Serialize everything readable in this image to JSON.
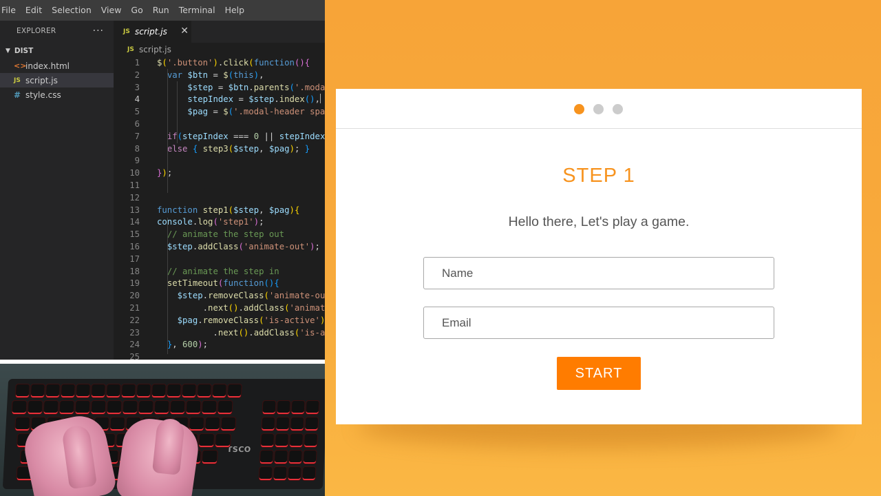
{
  "menubar": {
    "items": [
      "File",
      "Edit",
      "Selection",
      "View",
      "Go",
      "Run",
      "Terminal",
      "Help"
    ]
  },
  "explorer": {
    "title": "EXPLORER",
    "more": "···",
    "folder": "DIST",
    "files": [
      {
        "name": "index.html",
        "icon": "html-file-icon",
        "glyph": "<>"
      },
      {
        "name": "script.js",
        "icon": "js-file-icon",
        "glyph": "JS"
      },
      {
        "name": "style.css",
        "icon": "css-file-icon",
        "glyph": "#"
      }
    ],
    "active_file": "script.js"
  },
  "tab": {
    "label": "script.js",
    "icon_glyph": "JS",
    "close": "✕"
  },
  "breadcrumb": {
    "icon_glyph": "JS",
    "label": "script.js"
  },
  "editor": {
    "current_line": 4,
    "lines": [
      {
        "n": "1",
        "tokens": [
          [
            "fn",
            "$"
          ],
          [
            "t-brk1",
            "("
          ],
          [
            "str",
            "'.button'"
          ],
          [
            "t-brk1",
            ")"
          ],
          [
            "pun",
            "."
          ],
          [
            "fn",
            "click"
          ],
          [
            "t-brk1",
            "("
          ],
          [
            "kw",
            "function"
          ],
          [
            "t-brk2",
            "()"
          ],
          [
            "t-brk2",
            "{"
          ]
        ]
      },
      {
        "n": "2",
        "tokens": [
          [
            "pun",
            "  "
          ],
          [
            "kw",
            "var"
          ],
          [
            "pun",
            " "
          ],
          [
            "var",
            "$btn"
          ],
          [
            "pun",
            " = "
          ],
          [
            "fn",
            "$"
          ],
          [
            "t-brk3",
            "("
          ],
          [
            "kw",
            "this"
          ],
          [
            "t-brk3",
            ")"
          ],
          [
            "pun",
            ","
          ]
        ]
      },
      {
        "n": "3",
        "tokens": [
          [
            "pun",
            "      "
          ],
          [
            "var",
            "$step"
          ],
          [
            "pun",
            " = "
          ],
          [
            "var",
            "$btn"
          ],
          [
            "pun",
            "."
          ],
          [
            "fn",
            "parents"
          ],
          [
            "t-brk3",
            "("
          ],
          [
            "str",
            "'.modal"
          ]
        ]
      },
      {
        "n": "4",
        "tokens": [
          [
            "pun",
            "      "
          ],
          [
            "var",
            "stepIndex"
          ],
          [
            "pun",
            " = "
          ],
          [
            "var",
            "$step"
          ],
          [
            "pun",
            "."
          ],
          [
            "fn",
            "index"
          ],
          [
            "t-brk3",
            "()"
          ],
          [
            "pun",
            ","
          ],
          [
            "caret",
            ""
          ]
        ]
      },
      {
        "n": "5",
        "tokens": [
          [
            "pun",
            "      "
          ],
          [
            "var",
            "$pag"
          ],
          [
            "pun",
            " = "
          ],
          [
            "fn",
            "$"
          ],
          [
            "t-brk3",
            "("
          ],
          [
            "str",
            "'.modal-header span"
          ]
        ]
      },
      {
        "n": "6",
        "tokens": []
      },
      {
        "n": "7",
        "tokens": [
          [
            "pun",
            "  "
          ],
          [
            "ctl",
            "if"
          ],
          [
            "t-brk3",
            "("
          ],
          [
            "var",
            "stepIndex"
          ],
          [
            "pun",
            " === "
          ],
          [
            "num",
            "0"
          ],
          [
            "pun",
            " || "
          ],
          [
            "var",
            "stepIndex"
          ]
        ]
      },
      {
        "n": "8",
        "tokens": [
          [
            "pun",
            "  "
          ],
          [
            "ctl",
            "else"
          ],
          [
            "pun",
            " "
          ],
          [
            "t-brk3",
            "{"
          ],
          [
            "pun",
            " "
          ],
          [
            "fn",
            "step3"
          ],
          [
            "t-brk1",
            "("
          ],
          [
            "var",
            "$step"
          ],
          [
            "pun",
            ", "
          ],
          [
            "var",
            "$pag"
          ],
          [
            "t-brk1",
            ")"
          ],
          [
            "pun",
            "; "
          ],
          [
            "t-brk3",
            "}"
          ]
        ]
      },
      {
        "n": "9",
        "tokens": []
      },
      {
        "n": "10",
        "tokens": [
          [
            "t-brk2",
            "}"
          ],
          [
            "t-brk1",
            ")"
          ],
          [
            "pun",
            ";"
          ]
        ]
      },
      {
        "n": "11",
        "tokens": []
      },
      {
        "n": "12",
        "tokens": []
      },
      {
        "n": "13",
        "tokens": [
          [
            "kw",
            "function"
          ],
          [
            "pun",
            " "
          ],
          [
            "fn",
            "step1"
          ],
          [
            "t-brk1",
            "("
          ],
          [
            "var",
            "$step"
          ],
          [
            "pun",
            ", "
          ],
          [
            "var",
            "$pag"
          ],
          [
            "t-brk1",
            ")"
          ],
          [
            "t-brk1",
            "{"
          ]
        ]
      },
      {
        "n": "14",
        "tokens": [
          [
            "var",
            "console"
          ],
          [
            "pun",
            "."
          ],
          [
            "fn",
            "log"
          ],
          [
            "t-brk2",
            "("
          ],
          [
            "str",
            "'step1'"
          ],
          [
            "t-brk2",
            ")"
          ],
          [
            "pun",
            ";"
          ]
        ]
      },
      {
        "n": "15",
        "tokens": [
          [
            "pun",
            "  "
          ],
          [
            "com",
            "// animate the step out"
          ]
        ]
      },
      {
        "n": "16",
        "tokens": [
          [
            "pun",
            "  "
          ],
          [
            "var",
            "$step"
          ],
          [
            "pun",
            "."
          ],
          [
            "fn",
            "addClass"
          ],
          [
            "t-brk2",
            "("
          ],
          [
            "str",
            "'animate-out'"
          ],
          [
            "t-brk2",
            ")"
          ],
          [
            "pun",
            ";"
          ]
        ]
      },
      {
        "n": "17",
        "tokens": []
      },
      {
        "n": "18",
        "tokens": [
          [
            "pun",
            "  "
          ],
          [
            "com",
            "// animate the step in"
          ]
        ]
      },
      {
        "n": "19",
        "tokens": [
          [
            "pun",
            "  "
          ],
          [
            "fn",
            "setTimeout"
          ],
          [
            "t-brk2",
            "("
          ],
          [
            "kw",
            "function"
          ],
          [
            "t-brk3",
            "()"
          ],
          [
            "t-brk3",
            "{"
          ]
        ]
      },
      {
        "n": "20",
        "tokens": [
          [
            "pun",
            "    "
          ],
          [
            "var",
            "$step"
          ],
          [
            "pun",
            "."
          ],
          [
            "fn",
            "removeClass"
          ],
          [
            "t-brk1",
            "("
          ],
          [
            "str",
            "'animate-out"
          ]
        ]
      },
      {
        "n": "21",
        "tokens": [
          [
            "pun",
            "         ."
          ],
          [
            "fn",
            "next"
          ],
          [
            "t-brk1",
            "()"
          ],
          [
            "pun",
            "."
          ],
          [
            "fn",
            "addClass"
          ],
          [
            "t-brk1",
            "("
          ],
          [
            "str",
            "'animate"
          ]
        ]
      },
      {
        "n": "22",
        "tokens": [
          [
            "pun",
            "    "
          ],
          [
            "var",
            "$pag"
          ],
          [
            "pun",
            "."
          ],
          [
            "fn",
            "removeClass"
          ],
          [
            "t-brk1",
            "("
          ],
          [
            "str",
            "'is-active'"
          ],
          [
            "t-brk1",
            ")"
          ]
        ]
      },
      {
        "n": "23",
        "tokens": [
          [
            "pun",
            "           ."
          ],
          [
            "fn",
            "next"
          ],
          [
            "t-brk1",
            "()"
          ],
          [
            "pun",
            "."
          ],
          [
            "fn",
            "addClass"
          ],
          [
            "t-brk1",
            "("
          ],
          [
            "str",
            "'is-act"
          ]
        ]
      },
      {
        "n": "24",
        "tokens": [
          [
            "pun",
            "  "
          ],
          [
            "t-brk3",
            "}"
          ],
          [
            "pun",
            ", "
          ],
          [
            "num",
            "600"
          ],
          [
            "t-brk2",
            ")"
          ],
          [
            "pun",
            ";"
          ]
        ]
      },
      {
        "n": "25",
        "tokens": []
      }
    ]
  },
  "camera": {
    "keyboard_brand": "TSCO"
  },
  "preview": {
    "pagination": {
      "count": 3,
      "active_index": 0
    },
    "step_title": "STEP 1",
    "step_text": "Hello there, Let's play a game.",
    "name_placeholder": "Name",
    "email_placeholder": "Email",
    "start_label": "START",
    "accent_color": "#f7931e",
    "button_color": "#ff7c00"
  }
}
